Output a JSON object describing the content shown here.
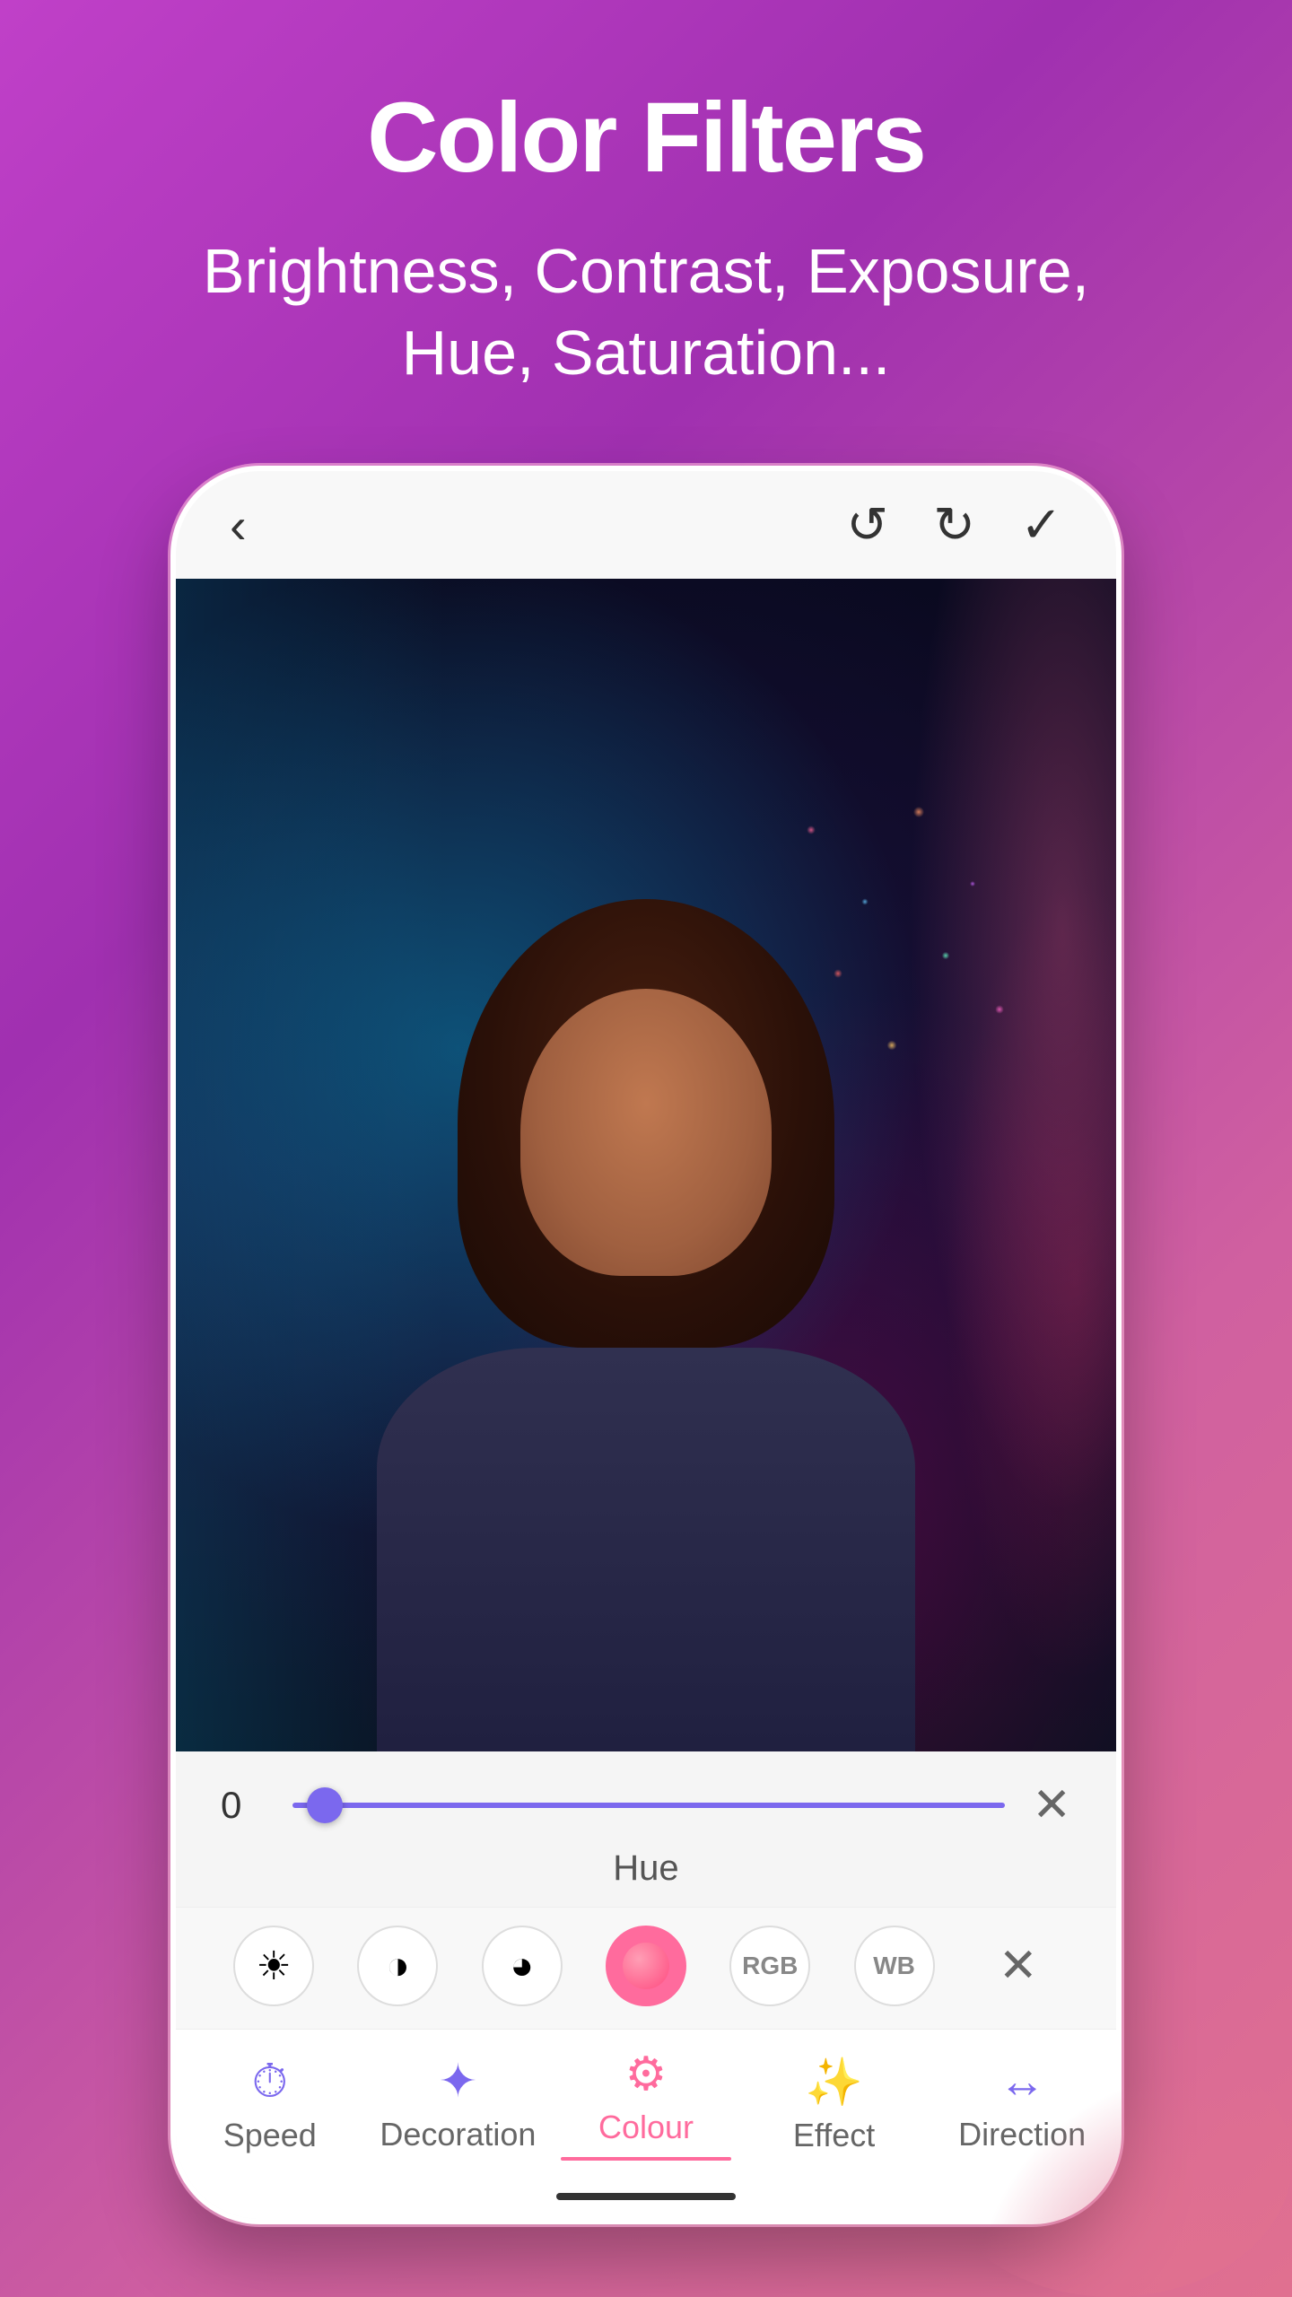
{
  "page": {
    "title": "Color Filters",
    "subtitle": "Brightness, Contrast, Exposure, Hue, Saturation...",
    "background_colors": {
      "top": "#c040c8",
      "bottom": "#e07090"
    }
  },
  "phone": {
    "topbar": {
      "back_label": "‹",
      "undo_label": "↺",
      "redo_label": "↻",
      "confirm_label": "✓"
    },
    "slider": {
      "value": "0",
      "label": "Hue",
      "close_label": "✕"
    },
    "filter_icons": [
      {
        "name": "brightness",
        "symbol": "☀",
        "active": false
      },
      {
        "name": "contrast",
        "symbol": "◑",
        "active": false
      },
      {
        "name": "exposure",
        "symbol": "◕",
        "active": false
      },
      {
        "name": "hue",
        "symbol": "●",
        "active": true
      },
      {
        "name": "rgb",
        "symbol": "RGB",
        "active": false
      },
      {
        "name": "wb",
        "symbol": "WB",
        "active": false
      },
      {
        "name": "close",
        "symbol": "✕",
        "active": false
      }
    ],
    "nav_items": [
      {
        "id": "speed",
        "label": "Speed",
        "icon": "⏱",
        "active": false
      },
      {
        "id": "decoration",
        "label": "Decoration",
        "icon": "✦",
        "active": false
      },
      {
        "id": "colour",
        "label": "Colour",
        "icon": "⚙",
        "active": true
      },
      {
        "id": "effect",
        "label": "Effect",
        "icon": "✨",
        "active": false
      },
      {
        "id": "direction",
        "label": "Direction",
        "icon": "↔",
        "active": false
      }
    ]
  }
}
